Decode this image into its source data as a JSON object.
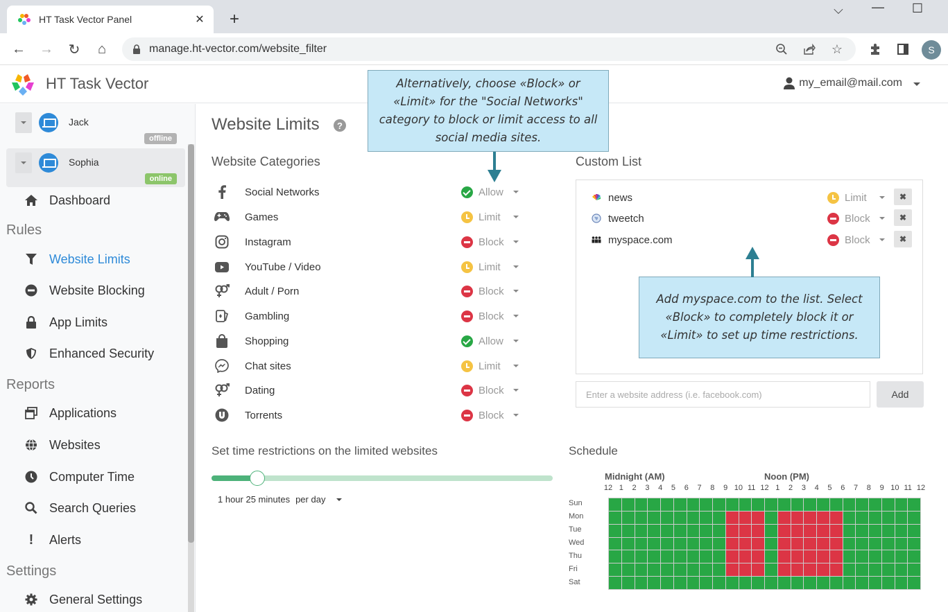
{
  "browser": {
    "tab_title": "HT Task Vector Panel",
    "url": "manage.ht-vector.com/website_filter",
    "profile_initial": "S"
  },
  "app": {
    "title": "HT Task Vector",
    "user_email": "my_email@mail.com"
  },
  "sidebar": {
    "devices": [
      {
        "name": "Jack",
        "status": "offline"
      },
      {
        "name": "Sophia",
        "status": "online"
      }
    ],
    "dashboard": "Dashboard",
    "sections": [
      {
        "title": "Rules",
        "items": [
          {
            "label": "Website Limits",
            "icon": "filter-icon",
            "active": true
          },
          {
            "label": "Website Blocking",
            "icon": "minus-circle-icon"
          },
          {
            "label": "App Limits",
            "icon": "lock-icon"
          },
          {
            "label": "Enhanced Security",
            "icon": "shield-icon"
          }
        ]
      },
      {
        "title": "Reports",
        "items": [
          {
            "label": "Applications",
            "icon": "windows-icon"
          },
          {
            "label": "Websites",
            "icon": "globe-icon"
          },
          {
            "label": "Computer Time",
            "icon": "clock-icon"
          },
          {
            "label": "Search Queries",
            "icon": "search-icon"
          },
          {
            "label": "Alerts",
            "icon": "exclamation-icon"
          }
        ]
      },
      {
        "title": "Settings",
        "items": [
          {
            "label": "General Settings",
            "icon": "gear-icon"
          }
        ]
      }
    ]
  },
  "main": {
    "page_title": "Website Limits",
    "categories_heading": "Website Categories",
    "categories": [
      {
        "name": "Social Networks",
        "icon": "facebook-icon",
        "status": "Allow"
      },
      {
        "name": "Games",
        "icon": "gamepad-icon",
        "status": "Limit"
      },
      {
        "name": "Instagram",
        "icon": "instagram-icon",
        "status": "Block"
      },
      {
        "name": "YouTube / Video",
        "icon": "youtube-icon",
        "status": "Limit"
      },
      {
        "name": "Adult / Porn",
        "icon": "gender-icon",
        "status": "Block"
      },
      {
        "name": "Gambling",
        "icon": "cards-icon",
        "status": "Block"
      },
      {
        "name": "Shopping",
        "icon": "shopping-bag-icon",
        "status": "Allow"
      },
      {
        "name": "Chat sites",
        "icon": "messenger-icon",
        "status": "Limit"
      },
      {
        "name": "Dating",
        "icon": "gender-icon",
        "status": "Block"
      },
      {
        "name": "Torrents",
        "icon": "utorrent-icon",
        "status": "Block"
      }
    ],
    "custom_list_heading": "Custom List",
    "custom_list": [
      {
        "name": "news",
        "icon": "nbc-peacock-icon",
        "status": "Limit"
      },
      {
        "name": "tweetch",
        "icon": "globe-icon",
        "status": "Block"
      },
      {
        "name": "myspace.com",
        "icon": "people-icon",
        "status": "Block"
      }
    ],
    "add_placeholder": "Enter a website address (i.e. facebook.com)",
    "add_value": "",
    "add_button": "Add",
    "time_heading": "Set time restrictions on the limited websites",
    "time_value": "1 hour 25 minutes",
    "time_period": "per day",
    "slider_fraction": 0.135,
    "schedule_heading": "Schedule"
  },
  "schedule": {
    "am_label": "Midnight (AM)",
    "pm_label": "Noon (PM)",
    "hour_labels": [
      "12",
      "1",
      "2",
      "3",
      "4",
      "5",
      "6",
      "7",
      "8",
      "9",
      "10",
      "11",
      "12",
      "1",
      "2",
      "3",
      "4",
      "5",
      "6",
      "7",
      "8",
      "9",
      "10",
      "11",
      "12"
    ],
    "days": [
      "Sun",
      "Mon",
      "Tue",
      "Wed",
      "Thu",
      "Fri",
      "Sat"
    ],
    "blocked_hours_weekdays": [
      9,
      10,
      11,
      13,
      14,
      15,
      16,
      17
    ],
    "blocked_days": [
      "Mon",
      "Tue",
      "Wed",
      "Thu",
      "Fri"
    ],
    "colors": {
      "allowed": "#28a745",
      "blocked": "#dc3545"
    }
  },
  "callouts": {
    "top": "Alternatively, choose «Block» or «Limit» for the \"Social Networks\" category to block or limit access to all social media sites.",
    "bottom": "Add myspace.com to the list. Select «Block» to completely block it or «Limit» to set up time restrictions."
  },
  "colors": {
    "accent": "#2e8ad8",
    "allow": "#28a745",
    "limit": "#f5c343",
    "block": "#dc3545",
    "callout_bg": "#c6e8f7",
    "arrow": "#2d7f92"
  }
}
